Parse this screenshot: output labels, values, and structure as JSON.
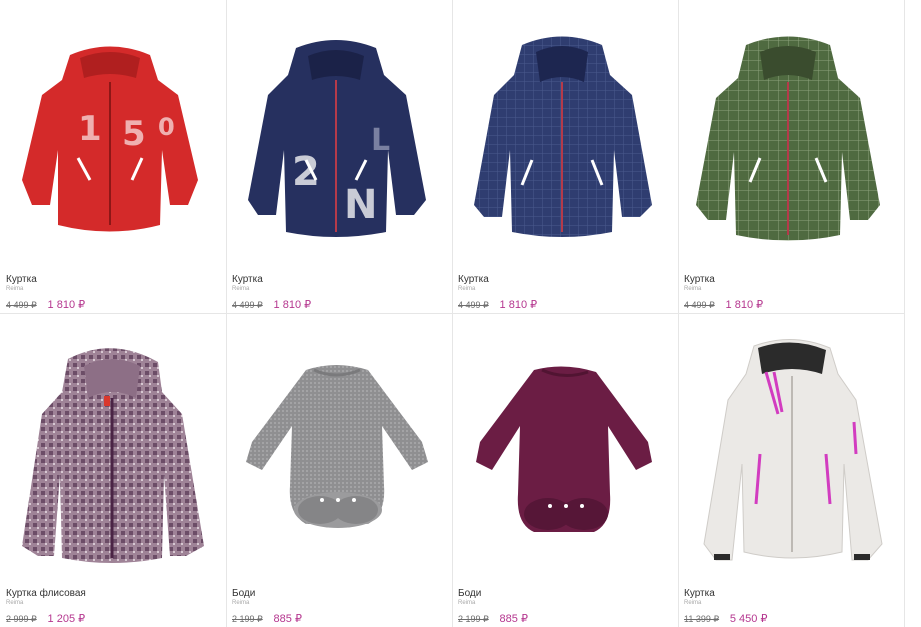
{
  "accent_color": "#b5378f",
  "products": [
    {
      "name": "Куртка",
      "brand": "Reima",
      "old_price": "4 499 ₽",
      "price": "1 810 ₽",
      "image": "red-jacket-with-numbers"
    },
    {
      "name": "Куртка",
      "brand": "Reima",
      "old_price": "4 499 ₽",
      "price": "1 810 ₽",
      "image": "navy-jacket-with-letters"
    },
    {
      "name": "Куртка",
      "brand": "Reima",
      "old_price": "4 499 ₽",
      "price": "1 810 ₽",
      "image": "navy-checked-jacket"
    },
    {
      "name": "Куртка",
      "brand": "Reima",
      "old_price": "4 499 ₽",
      "price": "1 810 ₽",
      "image": "green-checked-jacket"
    },
    {
      "name": "Куртка флисовая",
      "brand": "Reima",
      "old_price": "2 999 ₽",
      "price": "1 205 ₽",
      "image": "purple-fleece-jacket"
    },
    {
      "name": "Боди",
      "brand": "Reima",
      "old_price": "2 199 ₽",
      "price": "885 ₽",
      "image": "grey-wool-bodysuit"
    },
    {
      "name": "Боди",
      "brand": "Reima",
      "old_price": "2 199 ₽",
      "price": "885 ₽",
      "image": "burgundy-wool-bodysuit"
    },
    {
      "name": "Куртка",
      "brand": "Reima",
      "old_price": "11 399 ₽",
      "price": "5 450 ₽",
      "image": "white-ski-jacket"
    }
  ]
}
